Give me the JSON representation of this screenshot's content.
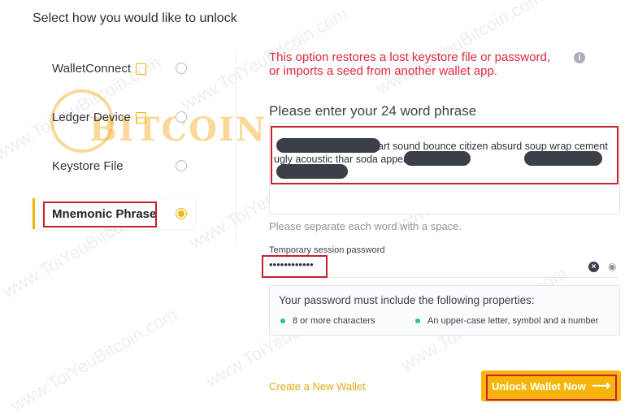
{
  "page": {
    "title": "Select how you would like to unlock"
  },
  "options": [
    {
      "label": "WalletConnect",
      "selected": false
    },
    {
      "label": "Ledger Device",
      "selected": false
    },
    {
      "label": "Keystore File",
      "selected": false
    },
    {
      "label": "Mnemonic Phrase",
      "selected": true
    }
  ],
  "warning": {
    "line1": "This option restores a lost keystore file or password,",
    "line2": "or imports a seed from another wallet app."
  },
  "phrase": {
    "heading": "Please enter your 24 word phrase",
    "visible_text": "art sound bounce citizen absurd soup wrap cement ugly acoustic thar soda appea ip",
    "hint": "Please separate each word with a space."
  },
  "password": {
    "label": "Temporary session password",
    "value": "••••••••••••"
  },
  "requirements": {
    "title": "Your password must include the following properties:",
    "items": [
      "8 or more characters",
      "An upper-case letter, symbol and a number"
    ]
  },
  "actions": {
    "create": "Create a New Wallet",
    "unlock": "Unlock Wallet Now",
    "unlock_arrow": "⟶"
  },
  "watermark": {
    "text": "www.ToiYeuBitcoin.com",
    "logo_text": "BITCOIN"
  },
  "colors": {
    "accent": "#f5b50a",
    "warning": "#e2253b",
    "success": "#2cc196",
    "highlight": "#c8202f"
  }
}
